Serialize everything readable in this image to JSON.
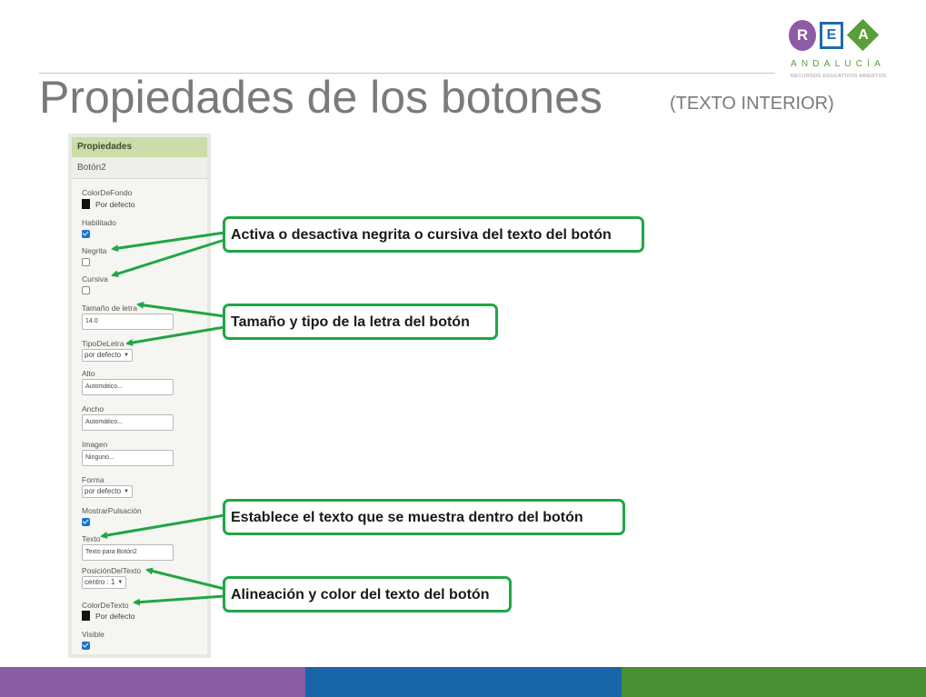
{
  "logo": {
    "letters": [
      "R",
      "E",
      "A"
    ],
    "name": "ANDALUCÍA",
    "subtitle": "RECURSOS EDUCATIVOS ABIERTOS",
    "colors": {
      "purple": "#8e5ba6",
      "blue": "#1f6bb0",
      "green": "#5a9e3a"
    }
  },
  "slide": {
    "title": "Propiedades de los botones",
    "subtitle": "(TEXTO INTERIOR)"
  },
  "panel": {
    "header": "Propiedades",
    "component": "Botón2",
    "props": {
      "color_fondo": {
        "label": "ColorDeFondo",
        "value": "Por defecto"
      },
      "habilitado": {
        "label": "Habilitado",
        "checked": true
      },
      "negrita": {
        "label": "Negrita",
        "checked": false
      },
      "cursiva": {
        "label": "Cursiva",
        "checked": false
      },
      "tamano_letra": {
        "label": "Tamaño de letra",
        "value": "14.0"
      },
      "tipo_letra": {
        "label": "TipoDeLetra",
        "value": "por defecto"
      },
      "alto": {
        "label": "Alto",
        "value": "Automático..."
      },
      "ancho": {
        "label": "Ancho",
        "value": "Automático..."
      },
      "imagen": {
        "label": "Imagen",
        "value": "Ninguno..."
      },
      "forma": {
        "label": "Forma",
        "value": "por defecto"
      },
      "mostrar_pulsacion": {
        "label": "MostrarPulsación",
        "checked": true
      },
      "texto": {
        "label": "Texto",
        "value": "Texto para Botón2"
      },
      "posicion_texto": {
        "label": "PosiciónDelTexto",
        "value": "centro : 1"
      },
      "color_texto": {
        "label": "ColorDeTexto",
        "value": "Por defecto"
      },
      "visible": {
        "label": "Visible",
        "checked": true
      }
    }
  },
  "callouts": {
    "bold_italic": "Activa o desactiva negrita o cursiva del texto del botón",
    "font": "Tamaño y tipo de la letra del botón",
    "text": "Establece el texto que se muestra dentro del botón",
    "alignment": "Alineación y color del texto del botón"
  },
  "colors": {
    "accent_green": "#21a545",
    "bar_purple": "#8a5ca4",
    "bar_blue": "#1965a9",
    "bar_green": "#4a8f35"
  }
}
